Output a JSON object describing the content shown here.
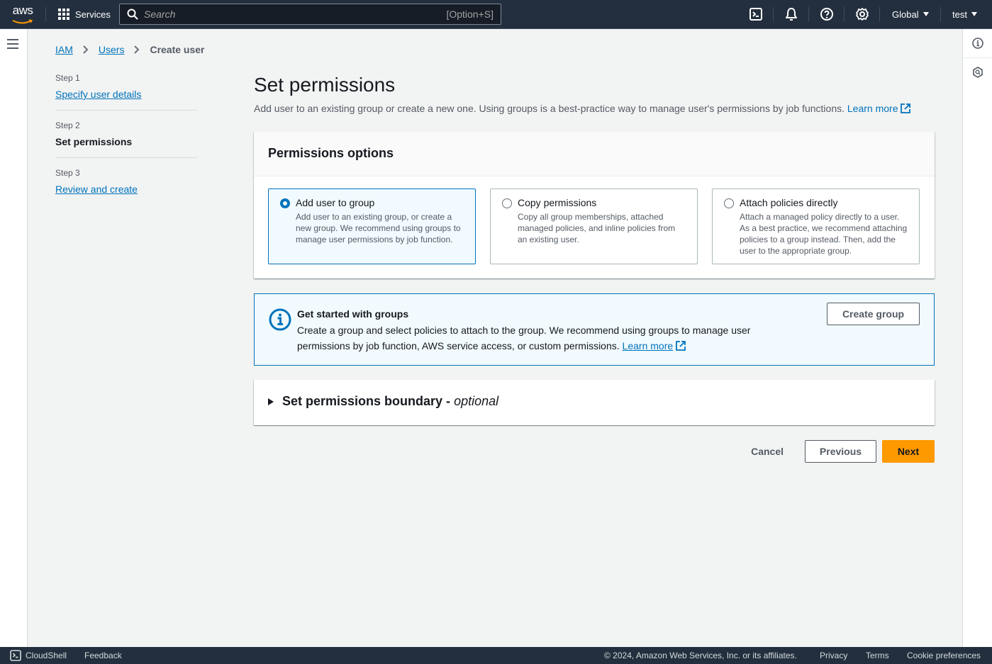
{
  "topnav": {
    "logo": "aws",
    "services_label": "Services",
    "search_placeholder": "Search",
    "search_shortcut": "[Option+S]",
    "icons": [
      "cloudshell-icon",
      "notifications-icon",
      "help-icon",
      "settings-icon"
    ],
    "region_label": "Global",
    "account_label": "test"
  },
  "breadcrumb": {
    "items": [
      {
        "label": "IAM",
        "link": true
      },
      {
        "label": "Users",
        "link": true
      },
      {
        "label": "Create user",
        "link": false
      }
    ]
  },
  "steps": [
    {
      "number": "Step 1",
      "label": "Specify user details",
      "state": "link"
    },
    {
      "number": "Step 2",
      "label": "Set permissions",
      "state": "current"
    },
    {
      "number": "Step 3",
      "label": "Review and create",
      "state": "link"
    }
  ],
  "main": {
    "title": "Set permissions",
    "description": "Add user to an existing group or create a new one. Using groups is a best-practice way to manage user's permissions by job functions.",
    "learn_more": "Learn more",
    "permissions_options": {
      "title": "Permissions options",
      "selected": 0,
      "options": [
        {
          "title": "Add user to group",
          "description": "Add user to an existing group, or create a new group. We recommend using groups to manage user permissions by job function."
        },
        {
          "title": "Copy permissions",
          "description": "Copy all group memberships, attached managed policies, and inline policies from an existing user."
        },
        {
          "title": "Attach policies directly",
          "description": "Attach a managed policy directly to a user. As a best practice, we recommend attaching policies to a group instead. Then, add the user to the appropriate group."
        }
      ]
    },
    "info_box": {
      "title": "Get started with groups",
      "text": "Create a group and select policies to attach to the group. We recommend using groups to manage user permissions by job function, AWS service access, or custom permissions.",
      "learn_more": "Learn more",
      "button": "Create group"
    },
    "boundary": {
      "title": "Set permissions boundary -",
      "optional": "optional",
      "expanded": false
    },
    "actions": {
      "cancel": "Cancel",
      "previous": "Previous",
      "next": "Next"
    }
  },
  "footer": {
    "cloudshell": "CloudShell",
    "feedback": "Feedback",
    "copyright": "© 2024, Amazon Web Services, Inc. or its affiliates.",
    "privacy": "Privacy",
    "terms": "Terms",
    "cookie_preferences": "Cookie preferences"
  },
  "colors": {
    "nav_bg": "#232f3e",
    "link": "#0073bb",
    "primary_button": "#ff9900"
  }
}
